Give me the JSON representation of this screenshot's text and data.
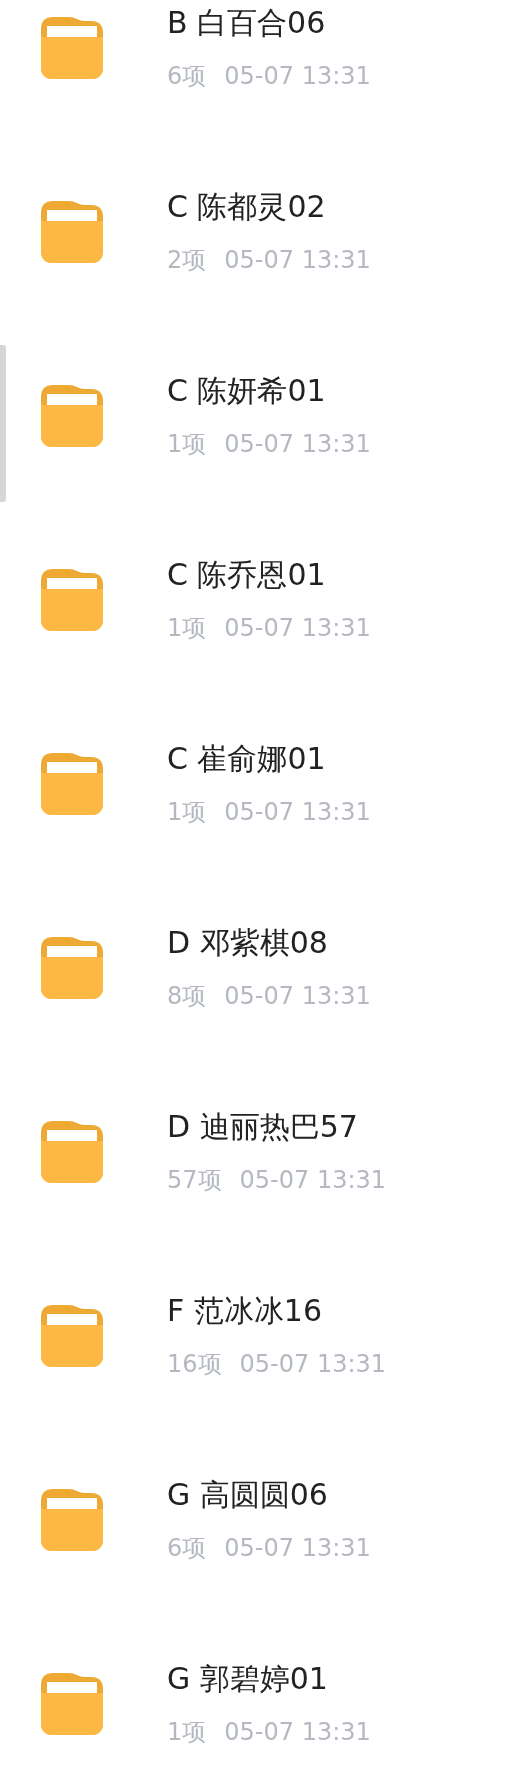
{
  "folders": [
    {
      "name": "B 白百合06",
      "count": "6项",
      "time": "05-07 13:31"
    },
    {
      "name": "C 陈都灵02",
      "count": "2项",
      "time": "05-07 13:31"
    },
    {
      "name": "C 陈妍希01",
      "count": "1项",
      "time": "05-07 13:31"
    },
    {
      "name": "C 陈乔恩01",
      "count": "1项",
      "time": "05-07 13:31"
    },
    {
      "name": "C 崔俞娜01",
      "count": "1项",
      "time": "05-07 13:31"
    },
    {
      "name": "D 邓紫棋08",
      "count": "8项",
      "time": "05-07 13:31"
    },
    {
      "name": "D 迪丽热巴57",
      "count": "57项",
      "time": "05-07 13:31"
    },
    {
      "name": "F 范冰冰16",
      "count": "16项",
      "time": "05-07 13:31"
    },
    {
      "name": "G 高圆圆06",
      "count": "6项",
      "time": "05-07 13:31"
    },
    {
      "name": "G 郭碧婷01",
      "count": "1项",
      "time": "05-07 13:31"
    }
  ]
}
